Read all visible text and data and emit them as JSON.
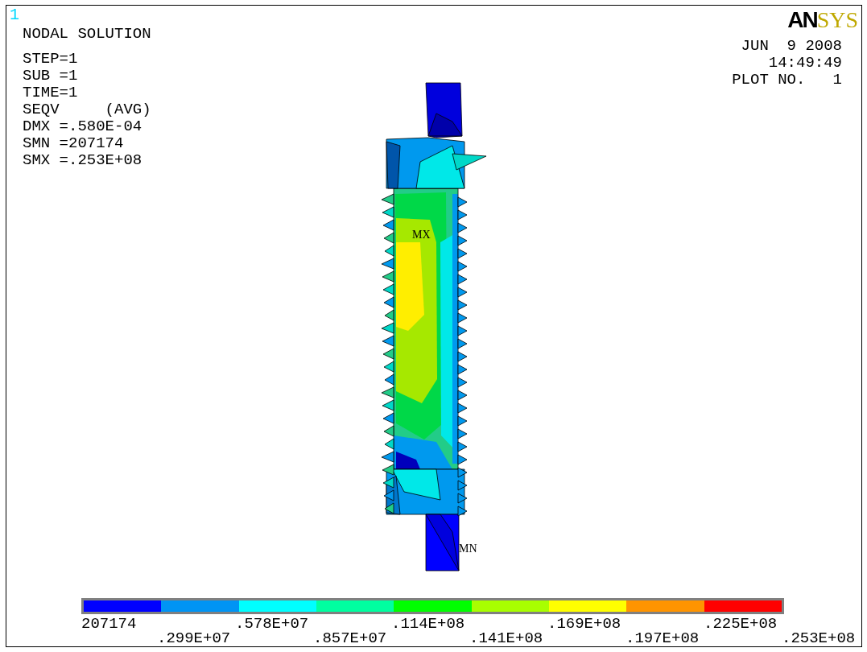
{
  "window_number": "1",
  "title": "NODAL SOLUTION",
  "info_lines": [
    "STEP=1",
    "SUB =1",
    "TIME=1",
    "SEQV     (AVG)",
    "DMX =.580E-04",
    "SMN =207174",
    "SMX =.253E+08"
  ],
  "logo": {
    "part_1": "AN",
    "part_2": "SYS"
  },
  "date": "JUN  9 2008",
  "time": "14:49:49",
  "plot_no": "PLOT NO.   1",
  "plot": {
    "max_label": "MX",
    "min_label": "MN"
  },
  "legend": {
    "bands": [
      {
        "color": "#0000ff"
      },
      {
        "color": "#0094f4"
      },
      {
        "color": "#00ffff"
      },
      {
        "color": "#00ffa0"
      },
      {
        "color": "#00ff00"
      },
      {
        "color": "#a8ff00"
      },
      {
        "color": "#ffff00"
      },
      {
        "color": "#ff9400"
      },
      {
        "color": "#ff0000"
      }
    ],
    "labels": [
      "207174",
      ".299E+07",
      ".578E+07",
      ".857E+07",
      ".114E+08",
      ".141E+08",
      ".169E+08",
      ".197E+08",
      ".225E+08",
      ".253E+08"
    ]
  }
}
